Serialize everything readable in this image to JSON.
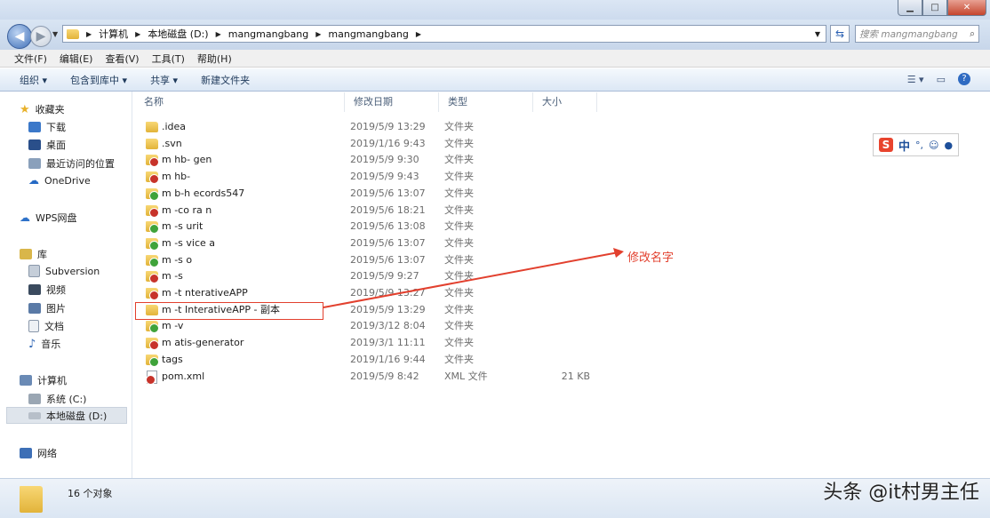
{
  "address": {
    "crumbs": [
      "计算机",
      "本地磁盘 (D:)",
      "mangmangbang",
      "mangmangbang"
    ],
    "search_placeholder": "搜索 mangmangbang"
  },
  "menu": [
    "文件(F)",
    "编辑(E)",
    "查看(V)",
    "工具(T)",
    "帮助(H)"
  ],
  "toolbar": {
    "organize": "组织 ▾",
    "include": "包含到库中 ▾",
    "share": "共享 ▾",
    "new_folder": "新建文件夹"
  },
  "sidebar": {
    "favorites": "收藏夹",
    "downloads": "下载",
    "desktop": "桌面",
    "recent": "最近访问的位置",
    "onedrive": "OneDrive",
    "wps": "WPS网盘",
    "libraries": "库",
    "subversion": "Subversion",
    "videos": "视频",
    "pictures": "图片",
    "documents": "文档",
    "music": "音乐",
    "computer": "计算机",
    "drive_c": "系统 (C:)",
    "drive_d": "本地磁盘 (D:)",
    "network": "网络"
  },
  "columns": {
    "name": "名称",
    "date": "修改日期",
    "type": "类型",
    "size": "大小"
  },
  "files": [
    {
      "name": ".idea",
      "date": "2019/5/9 13:29",
      "type": "文件夹",
      "size": "",
      "badge": "none"
    },
    {
      "name": ".svn",
      "date": "2019/1/16 9:43",
      "type": "文件夹",
      "size": "",
      "badge": "none"
    },
    {
      "name": "m  hb-   gen",
      "date": "2019/5/9 9:30",
      "type": "文件夹",
      "size": "",
      "badge": "red"
    },
    {
      "name": "m  hb-    ",
      "date": "2019/5/9 9:43",
      "type": "文件夹",
      "size": "",
      "badge": "red"
    },
    {
      "name": "m  b-h   ecords547",
      "date": "2019/5/6 13:07",
      "type": "文件夹",
      "size": "",
      "badge": "green"
    },
    {
      "name": "m   -co  ra  n",
      "date": "2019/5/6 18:21",
      "type": "文件夹",
      "size": "",
      "badge": "red"
    },
    {
      "name": "m   -s  urit",
      "date": "2019/5/6 13:08",
      "type": "文件夹",
      "size": "",
      "badge": "green"
    },
    {
      "name": "m   -s   vice  a",
      "date": "2019/5/6 13:07",
      "type": "文件夹",
      "size": "",
      "badge": "green"
    },
    {
      "name": "m   -s   o",
      "date": "2019/5/6 13:07",
      "type": "文件夹",
      "size": "",
      "badge": "green"
    },
    {
      "name": "m   -s   ",
      "date": "2019/5/9 9:27",
      "type": "文件夹",
      "size": "",
      "badge": "red"
    },
    {
      "name": "m   -t   nterativeAPP",
      "date": "2019/5/9 13:27",
      "type": "文件夹",
      "size": "",
      "badge": "red"
    },
    {
      "name": "m   -t   InterativeAPP - 副本",
      "date": "2019/5/9 13:29",
      "type": "文件夹",
      "size": "",
      "badge": "none"
    },
    {
      "name": "m   -v   ",
      "date": "2019/3/12 8:04",
      "type": "文件夹",
      "size": "",
      "badge": "green"
    },
    {
      "name": "m   atis-generator",
      "date": "2019/3/1 11:11",
      "type": "文件夹",
      "size": "",
      "badge": "red"
    },
    {
      "name": "tags",
      "date": "2019/1/16 9:44",
      "type": "文件夹",
      "size": "",
      "badge": "green"
    },
    {
      "name": "pom.xml",
      "date": "2019/5/9 8:42",
      "type": "XML 文件",
      "size": "21 KB",
      "badge": "file"
    }
  ],
  "annotation": "修改名字",
  "status": {
    "count": "16 个对象"
  },
  "ime": {
    "mode": "中"
  },
  "watermark": "头条 @it村男主任",
  "colors": {
    "annotation": "#e2402e",
    "badge_red": "#c7332a",
    "badge_green": "#3fa33a"
  }
}
